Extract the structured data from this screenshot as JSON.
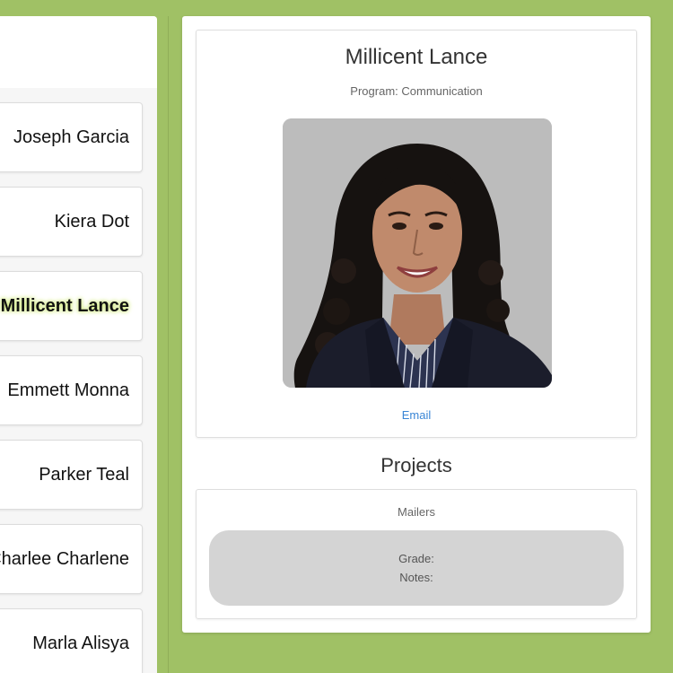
{
  "students": [
    {
      "name": "Joseph Garcia",
      "selected": false
    },
    {
      "name": "Kiera Dot",
      "selected": false
    },
    {
      "name": "Millicent Lance",
      "selected": true
    },
    {
      "name": "Emmett Monna",
      "selected": false
    },
    {
      "name": "Parker Teal",
      "selected": false
    },
    {
      "name": "Charlee Charlene",
      "selected": false
    },
    {
      "name": "Marla Alisya",
      "selected": false
    }
  ],
  "profile": {
    "name": "Millicent Lance",
    "program": "Program: Communication",
    "email_label": "Email"
  },
  "projects": {
    "heading": "Projects",
    "items": [
      {
        "name": "Mailers",
        "grade_label": "Grade:",
        "notes_label": "Notes:"
      }
    ]
  },
  "colors": {
    "background": "#a0c165",
    "link": "#3a86d6",
    "selected_glow": "#d9f08a",
    "project_details_bg": "#d4d4d4"
  }
}
